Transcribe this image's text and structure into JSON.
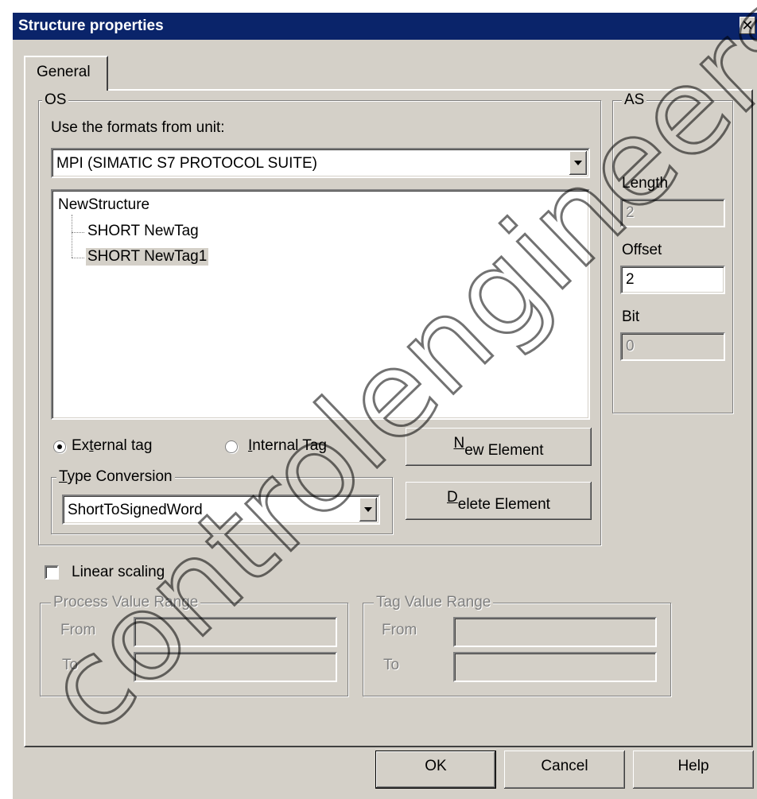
{
  "window": {
    "title": "Structure properties",
    "close_glyph": "✕"
  },
  "tabs": [
    {
      "label": "General",
      "selected": true
    }
  ],
  "os_group": {
    "legend": "OS",
    "formats_label": "Use the formats from unit:",
    "unit_select_value": "MPI (SIMATIC S7 PROTOCOL SUITE)",
    "tree": {
      "root": "NewStructure",
      "children": [
        "SHORT NewTag",
        "SHORT NewTag1"
      ],
      "selected_child": "SHORT NewTag1"
    },
    "radio_external": {
      "label_pre": "Ex",
      "label_mnemonic": "t",
      "label_post": "ernal tag",
      "checked": true
    },
    "radio_internal": {
      "label_pre": "",
      "label_mnemonic": "I",
      "label_post": "nternal Tag",
      "checked": false
    },
    "new_element_button": {
      "mnemonic": "N",
      "rest": "ew Element"
    },
    "delete_element_button": {
      "mnemonic": "D",
      "rest": "elete Element"
    },
    "type_conversion": {
      "legend_mnemonic": "T",
      "legend_rest": "ype Conversion",
      "value": "ShortToSignedWord"
    }
  },
  "as_group": {
    "legend": "AS",
    "length_label": "Length",
    "length_value": "2",
    "offset_label": "Offset",
    "offset_value": "2",
    "bit_label": "Bit",
    "bit_value": "0"
  },
  "linear_scaling": {
    "label": "Linear scaling",
    "checked": false
  },
  "process_value_range": {
    "legend": "Process Value Range",
    "from_label": "From",
    "to_label": "To",
    "from_value": "",
    "to_value": ""
  },
  "tag_value_range": {
    "legend": "Tag Value Range",
    "from_label": "From",
    "to_label": "To",
    "from_value": "",
    "to_value": ""
  },
  "footer": {
    "ok_label": "OK",
    "cancel_label": "Cancel",
    "help_label": "Help"
  },
  "colors": {
    "title_bar": "#0a246a",
    "face": "#d4d0c8",
    "watermark": "#000000"
  },
  "watermark_text": "controlengineers"
}
